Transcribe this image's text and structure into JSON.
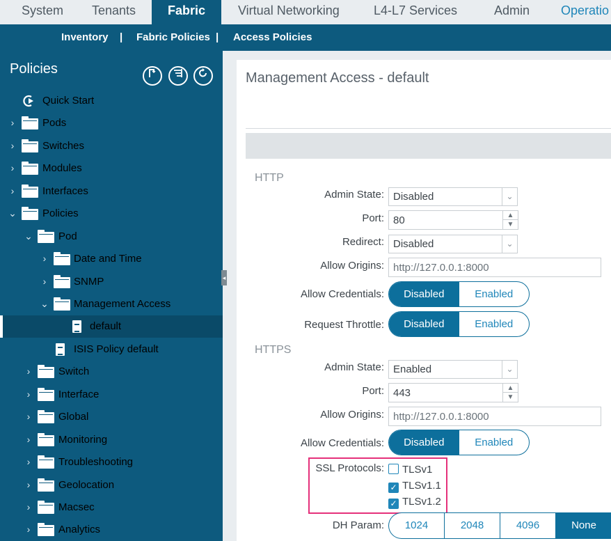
{
  "topnav": {
    "tabs": [
      "System",
      "Tenants",
      "Fabric",
      "Virtual Networking",
      "L4-L7 Services",
      "Admin",
      "Operatio"
    ],
    "active": "Fabric"
  },
  "subnav": {
    "items": [
      "Inventory",
      "Fabric Policies",
      "Access Policies"
    ],
    "separator": "|",
    "active": "Fabric Policies"
  },
  "sidebar": {
    "title": "Policies",
    "tools": [
      "filter-icon",
      "list-icon",
      "refresh-icon"
    ],
    "tree": [
      {
        "label": "Quick Start",
        "icon": "quick-start-icon"
      },
      {
        "label": "Pods",
        "icon": "folder-icon"
      },
      {
        "label": "Switches",
        "icon": "folder-icon"
      },
      {
        "label": "Modules",
        "icon": "folder-icon"
      },
      {
        "label": "Interfaces",
        "icon": "folder-icon"
      },
      {
        "label": "Policies",
        "icon": "folder-icon"
      },
      {
        "label": "Pod",
        "icon": "folder-icon"
      },
      {
        "label": "Date and Time",
        "icon": "folder-icon"
      },
      {
        "label": "SNMP",
        "icon": "folder-icon"
      },
      {
        "label": "Management Access",
        "icon": "folder-icon"
      },
      {
        "label": "default",
        "icon": "policy-icon"
      },
      {
        "label": "ISIS Policy default",
        "icon": "policy-icon"
      },
      {
        "label": "Switch",
        "icon": "folder-icon"
      },
      {
        "label": "Interface",
        "icon": "folder-icon"
      },
      {
        "label": "Global",
        "icon": "folder-icon"
      },
      {
        "label": "Monitoring",
        "icon": "folder-icon"
      },
      {
        "label": "Troubleshooting",
        "icon": "folder-icon"
      },
      {
        "label": "Geolocation",
        "icon": "folder-icon"
      },
      {
        "label": "Macsec",
        "icon": "folder-icon"
      },
      {
        "label": "Analytics",
        "icon": "folder-icon"
      }
    ],
    "selected": "default"
  },
  "form": {
    "title": "Management Access - default",
    "http": {
      "section": "HTTP",
      "admin_state_label": "Admin State:",
      "admin_state": "Disabled",
      "port_label": "Port:",
      "port": "80",
      "redirect_label": "Redirect:",
      "redirect": "Disabled",
      "allow_origins_label": "Allow Origins:",
      "allow_origins": "http://127.0.0.1:8000",
      "allow_credentials_label": "Allow Credentials:",
      "request_throttle_label": "Request Throttle:"
    },
    "https": {
      "section": "HTTPS",
      "admin_state_label": "Admin State:",
      "admin_state": "Enabled",
      "port_label": "Port:",
      "port": "443",
      "allow_origins_label": "Allow Origins:",
      "allow_origins": "http://127.0.0.1:8000",
      "allow_credentials_label": "Allow Credentials:",
      "ssl_label": "SSL Protocols:",
      "ssl": [
        {
          "label": "TLSv1",
          "checked": false
        },
        {
          "label": "TLSv1.1",
          "checked": true
        },
        {
          "label": "TLSv1.2",
          "checked": true
        }
      ],
      "dh_label": "DH Param:",
      "dh_options": [
        "1024",
        "2048",
        "4096",
        "None"
      ],
      "dh_selected": "None"
    },
    "toggle": {
      "disabled": "Disabled",
      "enabled": "Enabled"
    }
  },
  "colors": {
    "nav_blue": "#0d5a7e",
    "toggle_blue": "#0d6f9c",
    "link_blue": "#1f86b9",
    "highlight": "#e5307a"
  }
}
